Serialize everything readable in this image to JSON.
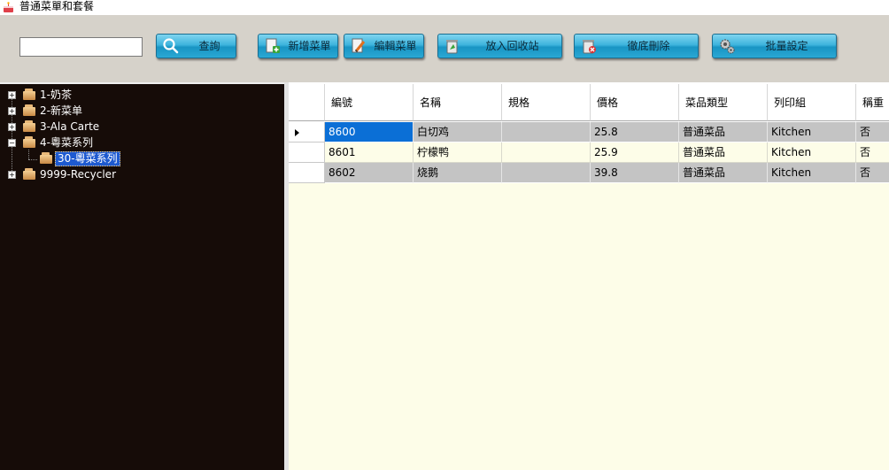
{
  "window": {
    "title": "普通菜單和套餐"
  },
  "toolbar": {
    "search_value": "",
    "search_placeholder": "",
    "query_label": "查詢",
    "new_label": "新增菜單",
    "edit_label": "編輯菜單",
    "recycle_label": "放入回收站",
    "delete_label": "徹底刪除",
    "batch_label": "批量設定"
  },
  "tree": {
    "nodes": [
      {
        "label": "1-奶茶",
        "expanded": false
      },
      {
        "label": "2-新菜单",
        "expanded": false
      },
      {
        "label": "3-Ala Carte",
        "expanded": false
      },
      {
        "label": "4-粵菜系列",
        "expanded": true,
        "children": [
          {
            "label": "30-粵菜系列",
            "selected": true
          }
        ]
      },
      {
        "label": "9999-Recycler",
        "expanded": false
      }
    ]
  },
  "grid": {
    "columns": [
      "編號",
      "名稱",
      "規格",
      "價格",
      "菜品類型",
      "列印組",
      "稱重"
    ],
    "rows": [
      {
        "code": "8600",
        "name": "白切鸡",
        "spec": "",
        "price": "25.8",
        "type": "普通菜品",
        "print_group": "Kitchen",
        "weighed": "否"
      },
      {
        "code": "8601",
        "name": "柠檬鸭",
        "spec": "",
        "price": "25.9",
        "type": "普通菜品",
        "print_group": "Kitchen",
        "weighed": "否"
      },
      {
        "code": "8602",
        "name": "烧鹅",
        "spec": "",
        "price": "39.8",
        "type": "普通菜品",
        "print_group": "Kitchen",
        "weighed": "否"
      }
    ],
    "selected_row": 0
  },
  "colors": {
    "toolbar_bg": "#d6d2ca",
    "button_accent": "#3eb4dd",
    "tree_bg": "#160c08",
    "grid_bg": "#fdfde8",
    "selection": "#0b6fd6"
  },
  "icons": {
    "app": "cake-icon",
    "query": "magnifier-icon",
    "new": "add-document-icon",
    "edit": "pencil-document-icon",
    "recycle": "recycle-bin-icon",
    "delete": "delete-bin-icon",
    "batch": "gears-icon",
    "folder": "folder-icon"
  }
}
